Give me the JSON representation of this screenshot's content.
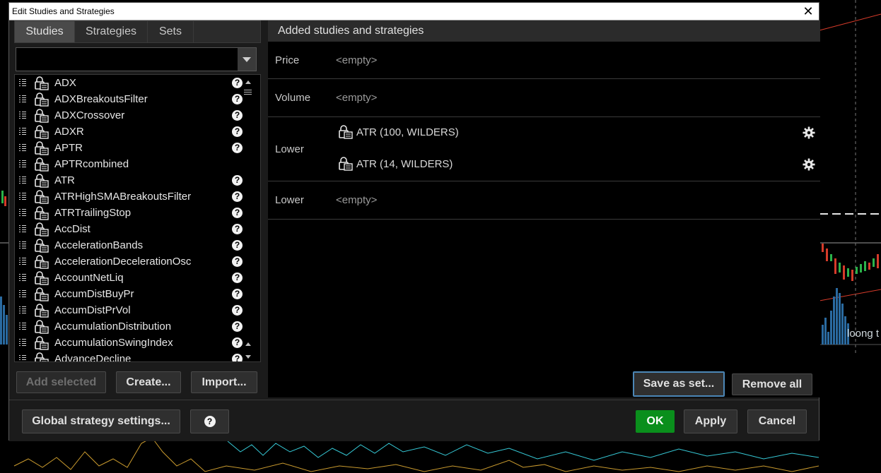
{
  "window": {
    "title": "Edit Studies and Strategies",
    "close_glyph": "✕"
  },
  "left_pane": {
    "tabs": [
      {
        "label": "Studies",
        "active": true
      },
      {
        "label": "Strategies",
        "active": false
      },
      {
        "label": "Sets",
        "active": false
      }
    ],
    "filter": {
      "value": "",
      "dropdown_icon": "chevron-down-icon"
    },
    "items": [
      {
        "name": "ADX",
        "help": true
      },
      {
        "name": "ADXBreakoutsFilter",
        "help": true
      },
      {
        "name": "ADXCrossover",
        "help": true
      },
      {
        "name": "ADXR",
        "help": true
      },
      {
        "name": "APTR",
        "help": true
      },
      {
        "name": "APTRcombined",
        "help": false
      },
      {
        "name": "ATR",
        "help": true
      },
      {
        "name": "ATRHighSMABreakoutsFilter",
        "help": true
      },
      {
        "name": "ATRTrailingStop",
        "help": true
      },
      {
        "name": "AccDist",
        "help": true
      },
      {
        "name": "AccelerationBands",
        "help": true
      },
      {
        "name": "AccelerationDecelerationOsc",
        "help": true
      },
      {
        "name": "AccountNetLiq",
        "help": true
      },
      {
        "name": "AccumDistBuyPr",
        "help": true
      },
      {
        "name": "AccumDistPrVol",
        "help": true
      },
      {
        "name": "AccumulationDistribution",
        "help": true
      },
      {
        "name": "AccumulationSwingIndex",
        "help": true
      },
      {
        "name": "AdvanceDecline",
        "help": true
      }
    ],
    "help_glyph": "?",
    "buttons": {
      "add_selected": "Add selected",
      "create": "Create...",
      "import": "Import..."
    }
  },
  "right_pane": {
    "header": "Added studies and strategies",
    "rows": [
      {
        "label": "Price",
        "empty_text": "<empty>"
      },
      {
        "label": "Volume",
        "empty_text": "<empty>"
      },
      {
        "label": "Lower",
        "studies": [
          "ATR (100, WILDERS)",
          "ATR (14, WILDERS)"
        ]
      },
      {
        "label": "Lower",
        "empty_text": "<empty>"
      }
    ],
    "buttons": {
      "save_as_set": "Save as set...",
      "remove_all": "Remove all"
    }
  },
  "bottom": {
    "global_settings": "Global strategy settings...",
    "help_glyph": "?",
    "ok": "OK",
    "apply": "Apply",
    "cancel": "Cancel"
  },
  "background": {
    "label": "loong t"
  },
  "colors": {
    "ok_green": "#0a8f1c",
    "focus_blue": "#4c87b7",
    "dialog_bg": "#1b1b1b",
    "chart_cyan": "#36c9d6",
    "chart_gold": "#c99a2e",
    "chart_red": "#d63b2a"
  }
}
